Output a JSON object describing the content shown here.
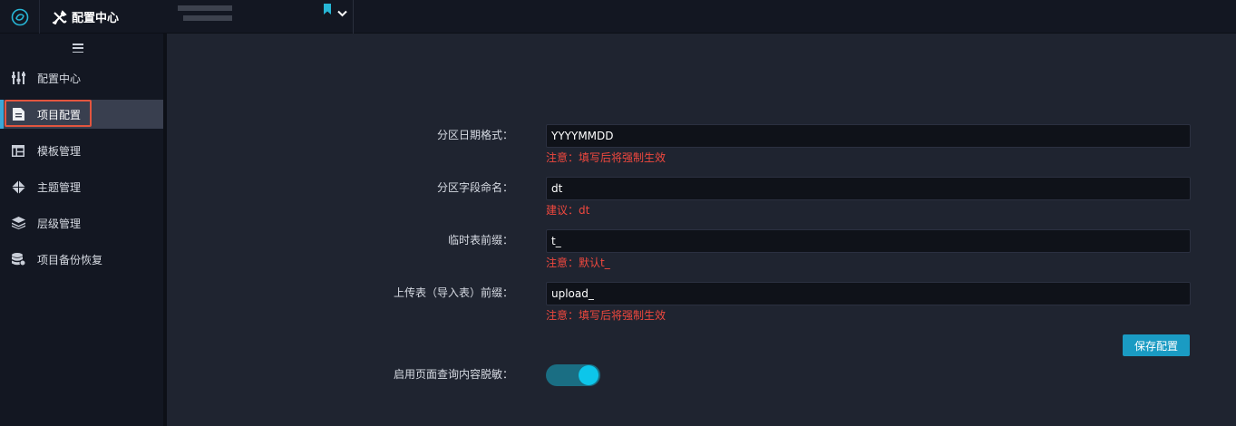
{
  "app": {
    "title": "配置中心"
  },
  "sidebar": {
    "items": [
      {
        "label": "配置中心",
        "icon": "sliders-icon",
        "active": false
      },
      {
        "label": "项目配置",
        "icon": "document-icon",
        "active": true
      },
      {
        "label": "模板管理",
        "icon": "table-icon",
        "active": false
      },
      {
        "label": "主题管理",
        "icon": "diamond-icon",
        "active": false
      },
      {
        "label": "层级管理",
        "icon": "layers-icon",
        "active": false
      },
      {
        "label": "项目备份恢复",
        "icon": "database-icon",
        "active": false
      }
    ]
  },
  "form": {
    "partition_date_format": {
      "label": "分区日期格式：",
      "value": "YYYYMMDD",
      "hint": "注意：填写后将强制生效"
    },
    "partition_field_name": {
      "label": "分区字段命名：",
      "value": "dt",
      "hint": "建议：dt"
    },
    "temp_table_prefix": {
      "label": "临时表前缀：",
      "value": "t_",
      "hint": "注意：默认t_"
    },
    "upload_table_prefix": {
      "label": "上传表（导入表）前缀：",
      "value": "upload_",
      "hint": "注意：填写后将强制生效"
    },
    "save_label": "保存配置",
    "desensitize": {
      "label": "启用页面查询内容脱敏：",
      "enabled": true
    }
  },
  "colors": {
    "accent": "#1a9bc3",
    "toggle_on": "#0dc6ea",
    "hint": "#f0483e",
    "active_marker": "#3aa7d8",
    "highlight_box": "#e3553f"
  }
}
